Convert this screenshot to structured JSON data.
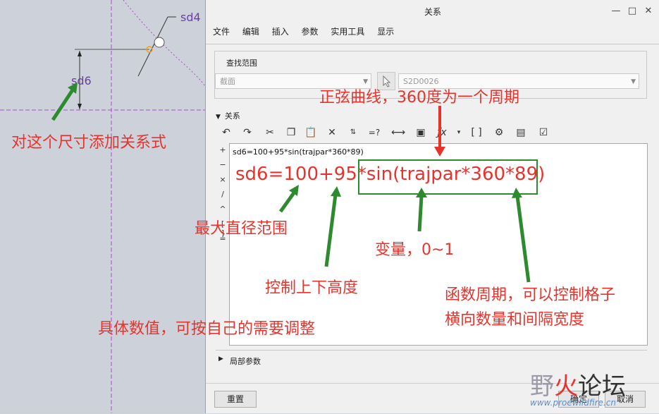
{
  "canvas": {
    "dim_sd4": "sd4",
    "dim_sd6": "sd6"
  },
  "dialog": {
    "title": "关系",
    "menu": [
      "文件",
      "编辑",
      "插入",
      "参数",
      "实用工具",
      "显示"
    ],
    "find_scope_label": "查找范围",
    "scope_combo": "截面",
    "id_combo": "S2D0026",
    "relations_header": "关系",
    "operators": [
      "+",
      "−",
      "×",
      "/",
      "^",
      "[ ]",
      "="
    ],
    "relation_code": "sd6=100+95*sin(trajpar*360*89)",
    "local_params": "局部参数",
    "reset_button": "重置",
    "ok_button": "确定",
    "cancel_button": "取消"
  },
  "annotations": {
    "dimension_note": "对这个尺寸添加关系式",
    "expression": "sd6=100+95*sin(trajpar*360*89)",
    "sine_note": "正弦曲线，360度为一个周期",
    "max_diameter": "最大直径范围",
    "height_control": "控制上下高度",
    "variable_note": "变量，0~1",
    "period_note_line1": "函数周期，可以控制格子",
    "period_note_line2": "横向数量和间隔宽度",
    "value_note": "具体数值，可按自己的需要调整"
  },
  "watermark": {
    "text_left": "野",
    "text_fire": "火",
    "text_right": "论坛",
    "url": "www.proewildfire.cn"
  },
  "colors": {
    "annotation_red": "#e8332c",
    "arrow_green": "#2e8a2e",
    "dimension_purple": "#6a3fa0",
    "axis_magenta": "#b04ad0"
  }
}
